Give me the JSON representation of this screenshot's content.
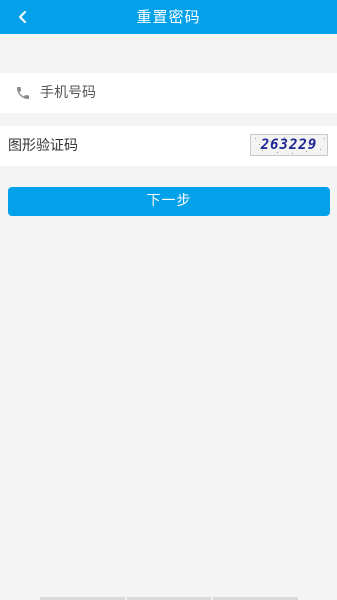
{
  "header": {
    "title": "重置密码",
    "back_icon": "chevron-left-icon"
  },
  "phone": {
    "icon": "phone-icon",
    "placeholder": "手机号码",
    "value": ""
  },
  "captcha": {
    "label": "图形验证码",
    "value": "",
    "image_text": "263229"
  },
  "actions": {
    "next_label": "下一步"
  },
  "colors": {
    "accent": "#03a1ea",
    "background": "#f4f4f4",
    "captcha_text": "#1f2597"
  }
}
